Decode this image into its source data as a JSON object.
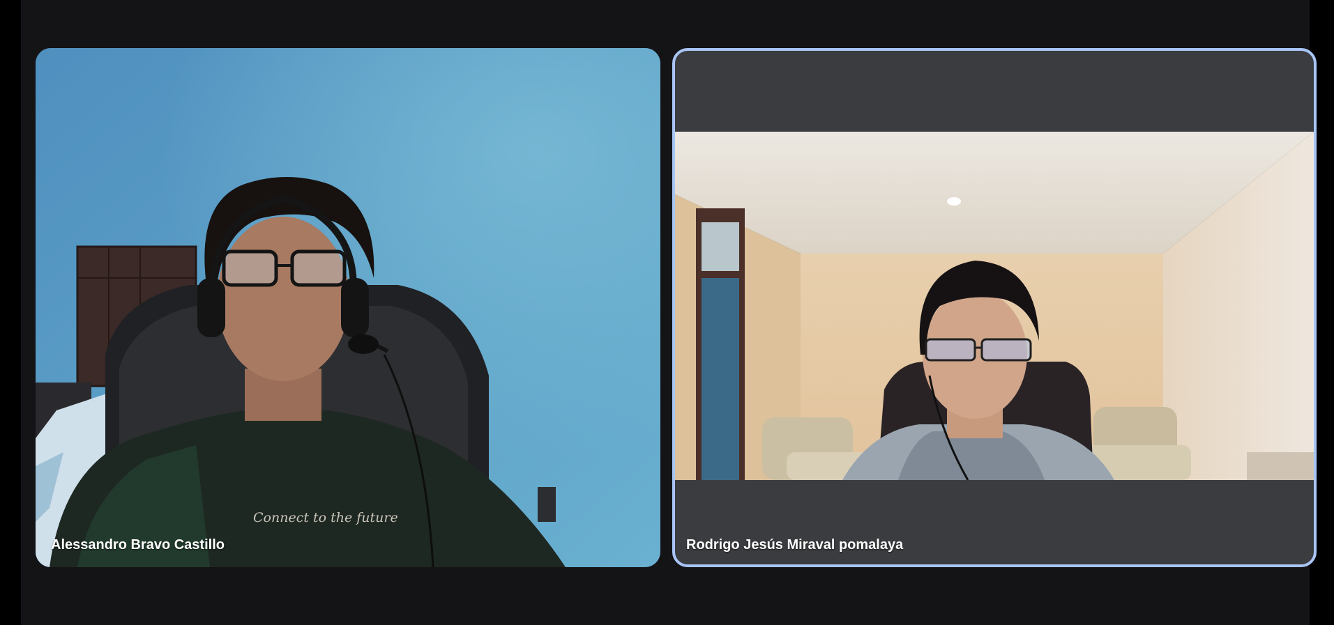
{
  "participants": [
    {
      "name": "Alessandro Bravo Castillo",
      "active_speaker": false,
      "shirt_print": "Connect to the future"
    },
    {
      "name": "Rodrigo Jesús Miraval pomalaya",
      "active_speaker": true
    }
  ],
  "colors": {
    "page_background": "#141316",
    "active_speaker_border": "#a8c5f5",
    "letterbox": "#3b3c40"
  }
}
